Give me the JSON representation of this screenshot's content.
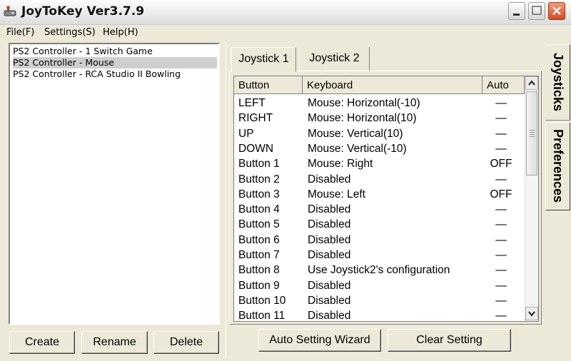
{
  "window": {
    "title": "JoyToKey Ver3.7.9"
  },
  "menu": {
    "items": [
      "File(F)",
      "Settings(S)",
      "Help(H)"
    ]
  },
  "profiles": {
    "items": [
      {
        "label": "PS2 Controller - 1 Switch Game",
        "selected": false
      },
      {
        "label": "PS2 Controller - Mouse",
        "selected": true
      },
      {
        "label": "PS2 Controller - RCA Studio II Bowling",
        "selected": false
      }
    ]
  },
  "profile_buttons": {
    "create": "Create",
    "rename": "Rename",
    "delete": "Delete"
  },
  "tabs": {
    "joystick1": "Joystick 1",
    "joystick2": "Joystick 2",
    "active": "joystick1"
  },
  "side_tabs": {
    "joysticks": "Joysticks",
    "preferences": "Preferences"
  },
  "grid": {
    "headers": {
      "button": "Button",
      "keyboard": "Keyboard",
      "auto": "Auto"
    },
    "rows": [
      {
        "button": "LEFT",
        "keyboard": "Mouse: Horizontal(-10)",
        "auto": "—"
      },
      {
        "button": "RIGHT",
        "keyboard": "Mouse: Horizontal(10)",
        "auto": "—"
      },
      {
        "button": "UP",
        "keyboard": "Mouse: Vertical(10)",
        "auto": "—"
      },
      {
        "button": "DOWN",
        "keyboard": "Mouse: Vertical(-10)",
        "auto": "—"
      },
      {
        "button": "Button 1",
        "keyboard": "Mouse: Right",
        "auto": "OFF"
      },
      {
        "button": "Button 2",
        "keyboard": "Disabled",
        "auto": "—"
      },
      {
        "button": "Button 3",
        "keyboard": "Mouse: Left",
        "auto": "OFF"
      },
      {
        "button": "Button 4",
        "keyboard": "Disabled",
        "auto": "—"
      },
      {
        "button": "Button 5",
        "keyboard": "Disabled",
        "auto": "—"
      },
      {
        "button": "Button 6",
        "keyboard": "Disabled",
        "auto": "—"
      },
      {
        "button": "Button 7",
        "keyboard": "Disabled",
        "auto": "—"
      },
      {
        "button": "Button 8",
        "keyboard": "Use Joystick2's configuration",
        "auto": "—"
      },
      {
        "button": "Button 9",
        "keyboard": "Disabled",
        "auto": "—"
      },
      {
        "button": "Button 10",
        "keyboard": "Disabled",
        "auto": "—"
      },
      {
        "button": "Button 11",
        "keyboard": "Disabled",
        "auto": "—"
      }
    ]
  },
  "bottom_buttons": {
    "wizard": "Auto Setting Wizard",
    "clear": "Clear Setting"
  },
  "colors": {
    "face": "#ece9d8",
    "close": "#d24b22",
    "selection": "#cfcfcf"
  }
}
